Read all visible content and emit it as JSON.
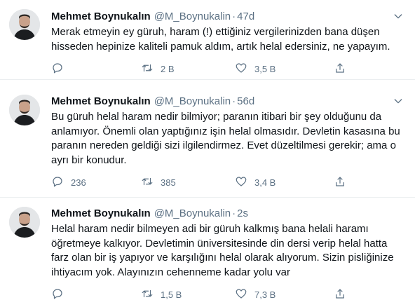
{
  "tweets": [
    {
      "name": "Mehmet Boynukalın",
      "handle": "@M_Boynukalin",
      "dot": "·",
      "time": "47d",
      "text": "Merak etmeyin ey güruh, haram (!) ettiğiniz vergilerinizden bana düşen\nhisseden hepinize kaliteli pamuk aldım, artık helal edersiniz, ne yapayım.",
      "replies": "",
      "retweets": "2 B",
      "likes": "3,5 B"
    },
    {
      "name": "Mehmet Boynukalın",
      "handle": "@M_Boynukalin",
      "dot": "·",
      "time": "56d",
      "text": "Bu güruh helal haram nedir bilmiyor; paranın itibari bir şey olduğunu da\nanlamıyor. Önemli olan yaptığınız işin helal olmasıdır. Devletin kasasına bu\nparanın nereden geldiği sizi ilgilendirmez. Evet düzeltilmesi gerekir; ama o\nayrı bir konudur.",
      "replies": "236",
      "retweets": "385",
      "likes": "3,4 B"
    },
    {
      "name": "Mehmet Boynukalın",
      "handle": "@M_Boynukalin",
      "dot": "·",
      "time": "2s",
      "text": "Helal haram nedir bilmeyen adi bir güruh kalkmış bana helali haramı\nöğretmeye kalkıyor. Devletimin üniversitesinde din dersi verip helal hatta\nfarz olan bir iş yapıyor ve karşılığını helal olarak alıyorum. Sizin pisliğinize\nihtiyacım yok. Alayınızın cehenneme kadar yolu var",
      "replies": "",
      "retweets": "1,5 B",
      "likes": "7,3 B"
    }
  ],
  "icons": {
    "reply": "reply-icon",
    "retweet": "retweet-icon",
    "like": "like-icon",
    "share": "share-icon",
    "more": "chevron-down-icon"
  },
  "colors": {
    "text": "#0f1419",
    "secondary": "#5b7083",
    "divider": "#ebeef0",
    "background": "#ffffff"
  }
}
